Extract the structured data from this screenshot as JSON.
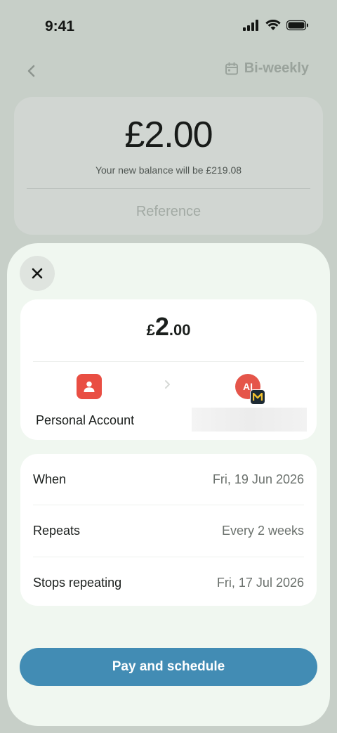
{
  "status_bar": {
    "time": "9:41"
  },
  "nav": {
    "frequency_label": "Bi-weekly"
  },
  "background_card": {
    "amount": "£2.00",
    "balance_text": "Your new balance will be £219.08",
    "reference_placeholder": "Reference"
  },
  "sheet": {
    "amount": {
      "currency": "£",
      "whole": "2",
      "decimal": ".00"
    },
    "from_account": "Personal Account",
    "to_avatar_initials": "AI",
    "details": [
      {
        "label": "When",
        "value": "Fri, 19 Jun 2026"
      },
      {
        "label": "Repeats",
        "value": "Every 2 weeks"
      },
      {
        "label": "Stops repeating",
        "value": "Fri, 17 Jul 2026"
      }
    ],
    "pay_button_label": "Pay and schedule"
  },
  "colors": {
    "primary_button": "#428cb4",
    "account_icon": "#e94e43",
    "sheet_background": "#f0f7f0"
  }
}
